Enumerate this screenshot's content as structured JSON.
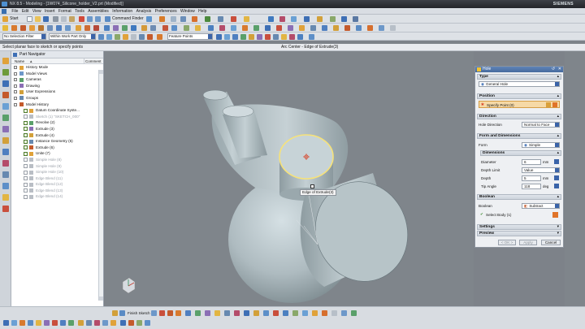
{
  "window": {
    "title": "NX 8.5 - Modeling - [1W074_Silicone_holder_V2.prt (Modified)]",
    "brand": "SIEMENS"
  },
  "menu": [
    "File",
    "Edit",
    "View",
    "Insert",
    "Format",
    "Tools",
    "Assemblies",
    "Information",
    "Analysis",
    "Preferences",
    "Window",
    "Help"
  ],
  "toolbar": {
    "start_label": "Start",
    "command_finder_label": "Command Finder"
  },
  "filters": {
    "selection_filter": "No Selection Filter",
    "scope": "Within Work Part Only",
    "snap": "Feature Points"
  },
  "status": {
    "prompt": "Select planar face to sketch or specify points",
    "selection_info": "Arc Center - Edge of Extrude(3)"
  },
  "navigator": {
    "title": "Part Navigator",
    "col_name": "Name",
    "col_comment": "Comment",
    "items": [
      {
        "label": "History Mode",
        "dim": false,
        "level": 0
      },
      {
        "label": "Model Views",
        "dim": false,
        "level": 0
      },
      {
        "label": "Cameras",
        "dim": false,
        "level": 0
      },
      {
        "label": "Drawing",
        "dim": false,
        "level": 0
      },
      {
        "label": "User Expressions",
        "dim": false,
        "level": 0
      },
      {
        "label": "Groups",
        "dim": false,
        "level": 0
      },
      {
        "label": "Model History",
        "dim": false,
        "level": 0
      },
      {
        "label": "Datum Coordinate Syste...",
        "dim": false,
        "level": 1
      },
      {
        "label": "Sketch (1) \"SKETCH_000\"",
        "dim": true,
        "level": 1
      },
      {
        "label": "Revolve (2)",
        "dim": false,
        "level": 1
      },
      {
        "label": "Extrude (3)",
        "dim": false,
        "level": 1
      },
      {
        "label": "Extrude (4)",
        "dim": false,
        "level": 1
      },
      {
        "label": "Instance Geometry (5)",
        "dim": false,
        "level": 1
      },
      {
        "label": "Extrude (6)",
        "dim": false,
        "level": 1
      },
      {
        "label": "Unite (7)",
        "dim": false,
        "level": 1
      },
      {
        "label": "Simple Hole (8)",
        "dim": true,
        "level": 1
      },
      {
        "label": "Simple Hole (9)",
        "dim": true,
        "level": 1
      },
      {
        "label": "Simple Hole (10)",
        "dim": true,
        "level": 1
      },
      {
        "label": "Edge Blend (11)",
        "dim": true,
        "level": 1
      },
      {
        "label": "Edge Blend (12)",
        "dim": true,
        "level": 1
      },
      {
        "label": "Edge Blend (13)",
        "dim": true,
        "level": 1
      },
      {
        "label": "Edge Blend (14)",
        "dim": true,
        "level": 1
      }
    ]
  },
  "viewport": {
    "tooltip": "Edge of Extrude(3)"
  },
  "hole_dialog": {
    "title": "Hole",
    "type_section": "Type",
    "type_value": "General Hole",
    "position_section": "Position",
    "specify_points": "Specify Point (0)",
    "direction_section": "Direction",
    "hole_direction_label": "Hole Direction",
    "hole_direction_value": "Normal to Face",
    "form_section": "Form and Dimensions",
    "form_label": "Form",
    "form_value": "Simple",
    "dimensions_section": "Dimensions",
    "diameter_label": "Diameter",
    "diameter_value": "6",
    "diameter_unit": "mm",
    "depth_limit_label": "Depth Limit",
    "depth_limit_value": "Value",
    "depth_label": "Depth",
    "depth_value": "5",
    "depth_unit": "mm",
    "tip_angle_label": "Tip Angle",
    "tip_angle_value": "118",
    "tip_angle_unit": "deg",
    "boolean_section": "Boolean",
    "boolean_label": "Boolean",
    "boolean_value": "Subtract",
    "select_body": "Select Body (1)",
    "settings_section": "Settings",
    "preview_section": "Preview",
    "ok": "< OK >",
    "apply": "Apply",
    "cancel": "Cancel"
  },
  "bottom": {
    "finish_sketch": "Finish Sketch"
  },
  "colors": {
    "model": "#b7c4c8",
    "highlight": "#f6e27a",
    "titlebar": "#2c2f35",
    "dialog_header": "#4f74a8"
  }
}
